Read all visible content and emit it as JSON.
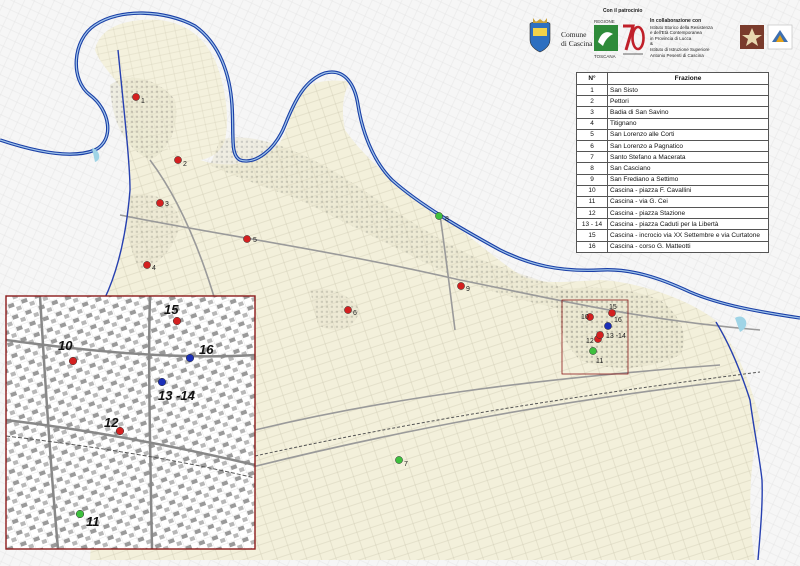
{
  "header": {
    "patrocinio": "Con il patrocinio",
    "comune": [
      "Comune",
      "di Cascina"
    ],
    "regione_top": "REGIONE",
    "regione_bottom": "TOSCANA",
    "collaborazione_title": "In collaborazione con",
    "collaborazione_lines": [
      "Istituto Storico della Resistenza",
      "e dell'Età Contemporanea",
      "in Provincia di Lucca",
      "&",
      "Istituto di Istruzione Superiore",
      "Antonio Pesenti di Cascina"
    ]
  },
  "legend": {
    "col_num": "N°",
    "col_name": "Frazione",
    "rows": [
      {
        "num": "1",
        "name": "San Sisto"
      },
      {
        "num": "2",
        "name": "Pettori"
      },
      {
        "num": "3",
        "name": "Badia di San Savino"
      },
      {
        "num": "4",
        "name": "Titignano"
      },
      {
        "num": "5",
        "name": "San Lorenzo alle Corti"
      },
      {
        "num": "6",
        "name": "San Lorenzo a Pagnatico"
      },
      {
        "num": "7",
        "name": "Santo Stefano a Macerata"
      },
      {
        "num": "8",
        "name": "San Casciano"
      },
      {
        "num": "9",
        "name": "San Frediano a Settimo"
      },
      {
        "num": "10",
        "name": "Cascina - piazza F. Cavallini"
      },
      {
        "num": "11",
        "name": "Cascina - via G. Cei"
      },
      {
        "num": "12",
        "name": "Cascina - piazza Stazione"
      },
      {
        "num": "13 - 14",
        "name": "Cascina - piazza Caduti per la Libertà"
      },
      {
        "num": "15",
        "name": "Cascina - incrocio via XX Settembre e via Curtatone"
      },
      {
        "num": "16",
        "name": "Cascina - corso G. Matteotti"
      }
    ]
  },
  "colors": {
    "river": "#1a3fa6",
    "boundary": "#2740b0",
    "marker_red": "#d42020",
    "marker_green": "#3ec03e",
    "marker_blue": "#1b2fb8",
    "inset_frame": "#8b1a1a",
    "terrain": "#f2efd9"
  },
  "markers": [
    {
      "label": "1",
      "color": "red"
    },
    {
      "label": "2",
      "color": "red"
    },
    {
      "label": "3",
      "color": "red"
    },
    {
      "label": "4",
      "color": "red"
    },
    {
      "label": "5",
      "color": "red"
    },
    {
      "label": "6",
      "color": "red"
    },
    {
      "label": "7",
      "color": "green"
    },
    {
      "label": "8",
      "color": "green"
    },
    {
      "label": "9",
      "color": "red"
    },
    {
      "label": "10",
      "color": "red"
    },
    {
      "label": "15",
      "color": "red"
    },
    {
      "label": "16",
      "color": "blue"
    },
    {
      "label": "12",
      "color": "red"
    },
    {
      "label": "13 -14",
      "color": "red"
    },
    {
      "label": "11",
      "color": "green"
    }
  ],
  "inset_markers": [
    {
      "label": "15",
      "color": "red"
    },
    {
      "label": "10",
      "color": "red"
    },
    {
      "label": "16",
      "color": "blue"
    },
    {
      "label": "13 -14",
      "color": "blue"
    },
    {
      "label": "12",
      "color": "red"
    },
    {
      "label": "11",
      "color": "green"
    }
  ]
}
